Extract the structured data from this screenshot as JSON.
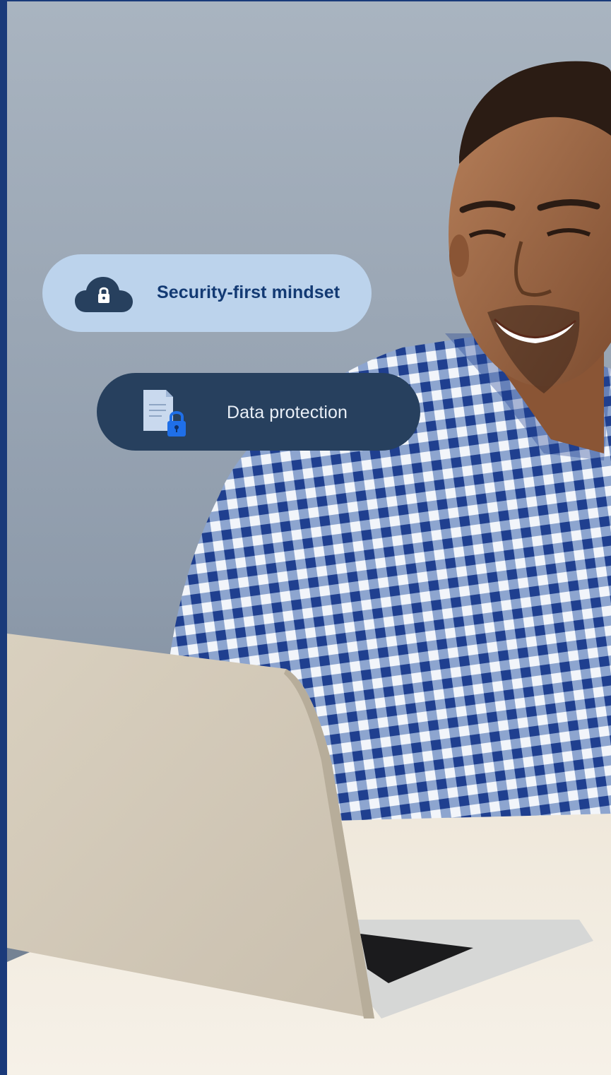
{
  "feature_badges": [
    {
      "label": "Security-first mindset",
      "icon": "cloud-lock-icon"
    },
    {
      "label": "Data protection",
      "icon": "document-lock-icon"
    }
  ],
  "photo": {
    "subject": "smiling-man-laptop-photo"
  },
  "colors": {
    "frame_border": "#1a3a7a",
    "background_top": "#a4afbb",
    "background_bottom": "#6f7f91",
    "badge_light_bg": "#bcd3ec",
    "badge_light_text": "#133a73",
    "badge_dark_bg": "#27405e",
    "badge_dark_text": "#e8eef6",
    "lock_accent": "#1f6fe8"
  }
}
